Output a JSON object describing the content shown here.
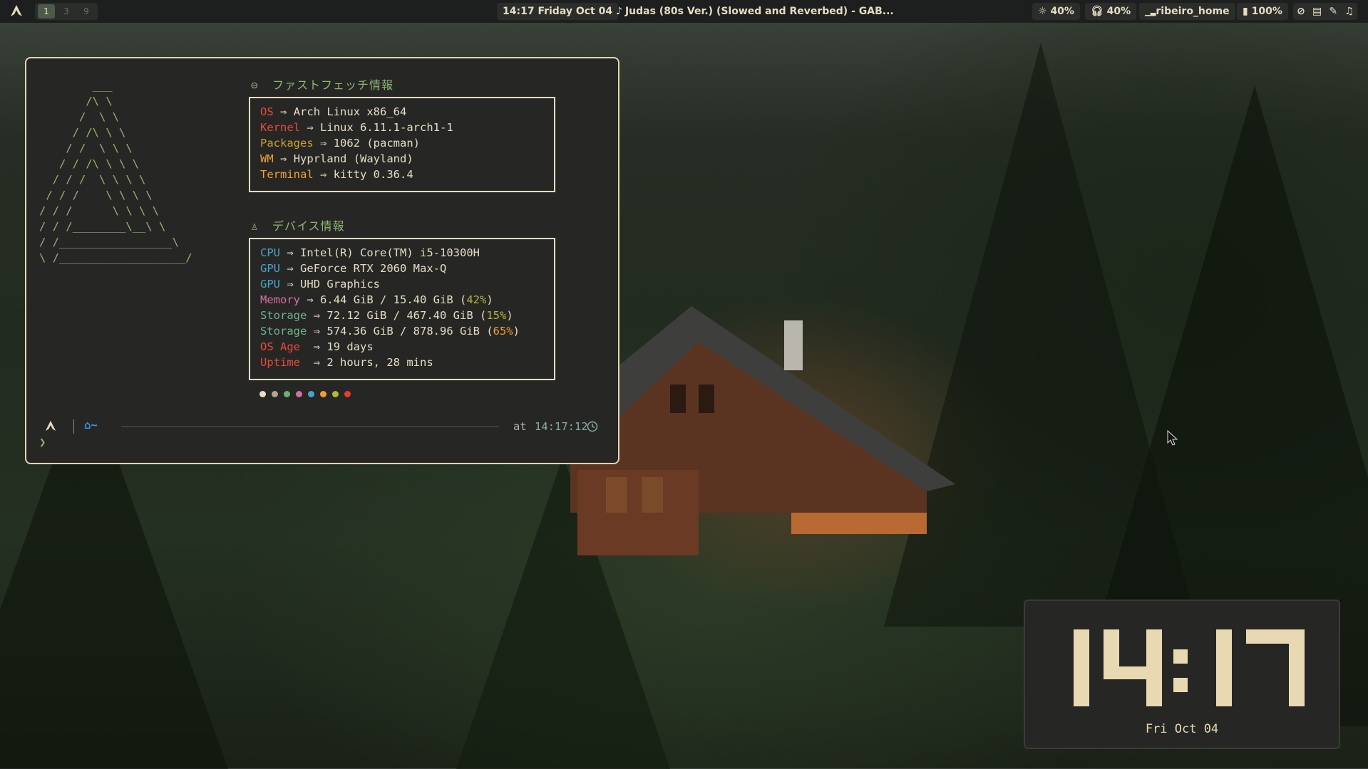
{
  "topbar": {
    "workspaces": [
      "1",
      "3",
      "9"
    ],
    "active_workspace": "1",
    "datetime": "14:17 Friday Oct 04",
    "now_playing": "Judas (80s Ver.) (Slowed and Reverbed) - GAB...",
    "brightness": "40%",
    "volume": "40%",
    "network": "ribeiro_home",
    "battery": "100%"
  },
  "fetch": {
    "section1_title": "ファストフェッチ情報",
    "section2_title": "デバイス情報",
    "arrow": "⇒",
    "software": [
      {
        "label": "OS",
        "value": "Arch Linux x86_64",
        "color": "#ea4a3c"
      },
      {
        "label": "Kernel",
        "value": "Linux 6.11.1-arch1-1",
        "color": "#ea4a3c"
      },
      {
        "label": "Packages",
        "value": "1062 (pacman)",
        "color": "#c9a227"
      },
      {
        "label": "WM",
        "value": "Hyprland (Wayland)",
        "color": "#f0a033"
      },
      {
        "label": "Terminal",
        "value": "kitty 0.36.4",
        "color": "#f0a033"
      }
    ],
    "device": [
      {
        "label": "CPU",
        "value": "Intel(R) Core(TM) i5-10300H",
        "color": "#4aa3c7"
      },
      {
        "label": "GPU",
        "value": "GeForce RTX 2060 Max-Q",
        "color": "#4aa3c7"
      },
      {
        "label": "GPU",
        "value": "UHD Graphics",
        "color": "#4aa3c7"
      },
      {
        "label": "Memory",
        "value": "6.44 GiB / 15.40 GiB (",
        "pct": "42%",
        "pct_color": "#b7b53a",
        "tail": ")",
        "color": "#d86fa3"
      },
      {
        "label": "Storage",
        "value": "72.12 GiB / 467.40 GiB (",
        "pct": "15%",
        "pct_color": "#b7b53a",
        "tail": ")",
        "color": "#6fb08c"
      },
      {
        "label": "Storage",
        "value": "574.36 GiB / 878.96 GiB (",
        "pct": "65%",
        "pct_color": "#f0a033",
        "tail": ")",
        "color": "#6fb08c"
      },
      {
        "label": "OS Age ",
        "value": "19 days",
        "color": "#ea4a3c"
      },
      {
        "label": "Uptime ",
        "value": "2 hours, 28 mins",
        "color": "#ea4a3c"
      }
    ],
    "palette": [
      "#eadfc5",
      "#b3a390",
      "#6fb06f",
      "#d06fa0",
      "#4aa3c7",
      "#f0a033",
      "#b7b53a",
      "#ea3b2e"
    ]
  },
  "prompt": {
    "home": "~",
    "at_label": "at",
    "time": "14:17:12",
    "cursor": "❯"
  },
  "clock_widget": {
    "time": "14:17",
    "date": "Fri Oct 04"
  },
  "colors": {
    "terminal_bg": "#262725",
    "terminal_border": "#e4d4b0",
    "accent_green": "#8fb573",
    "cream": "#e8d9b3"
  }
}
